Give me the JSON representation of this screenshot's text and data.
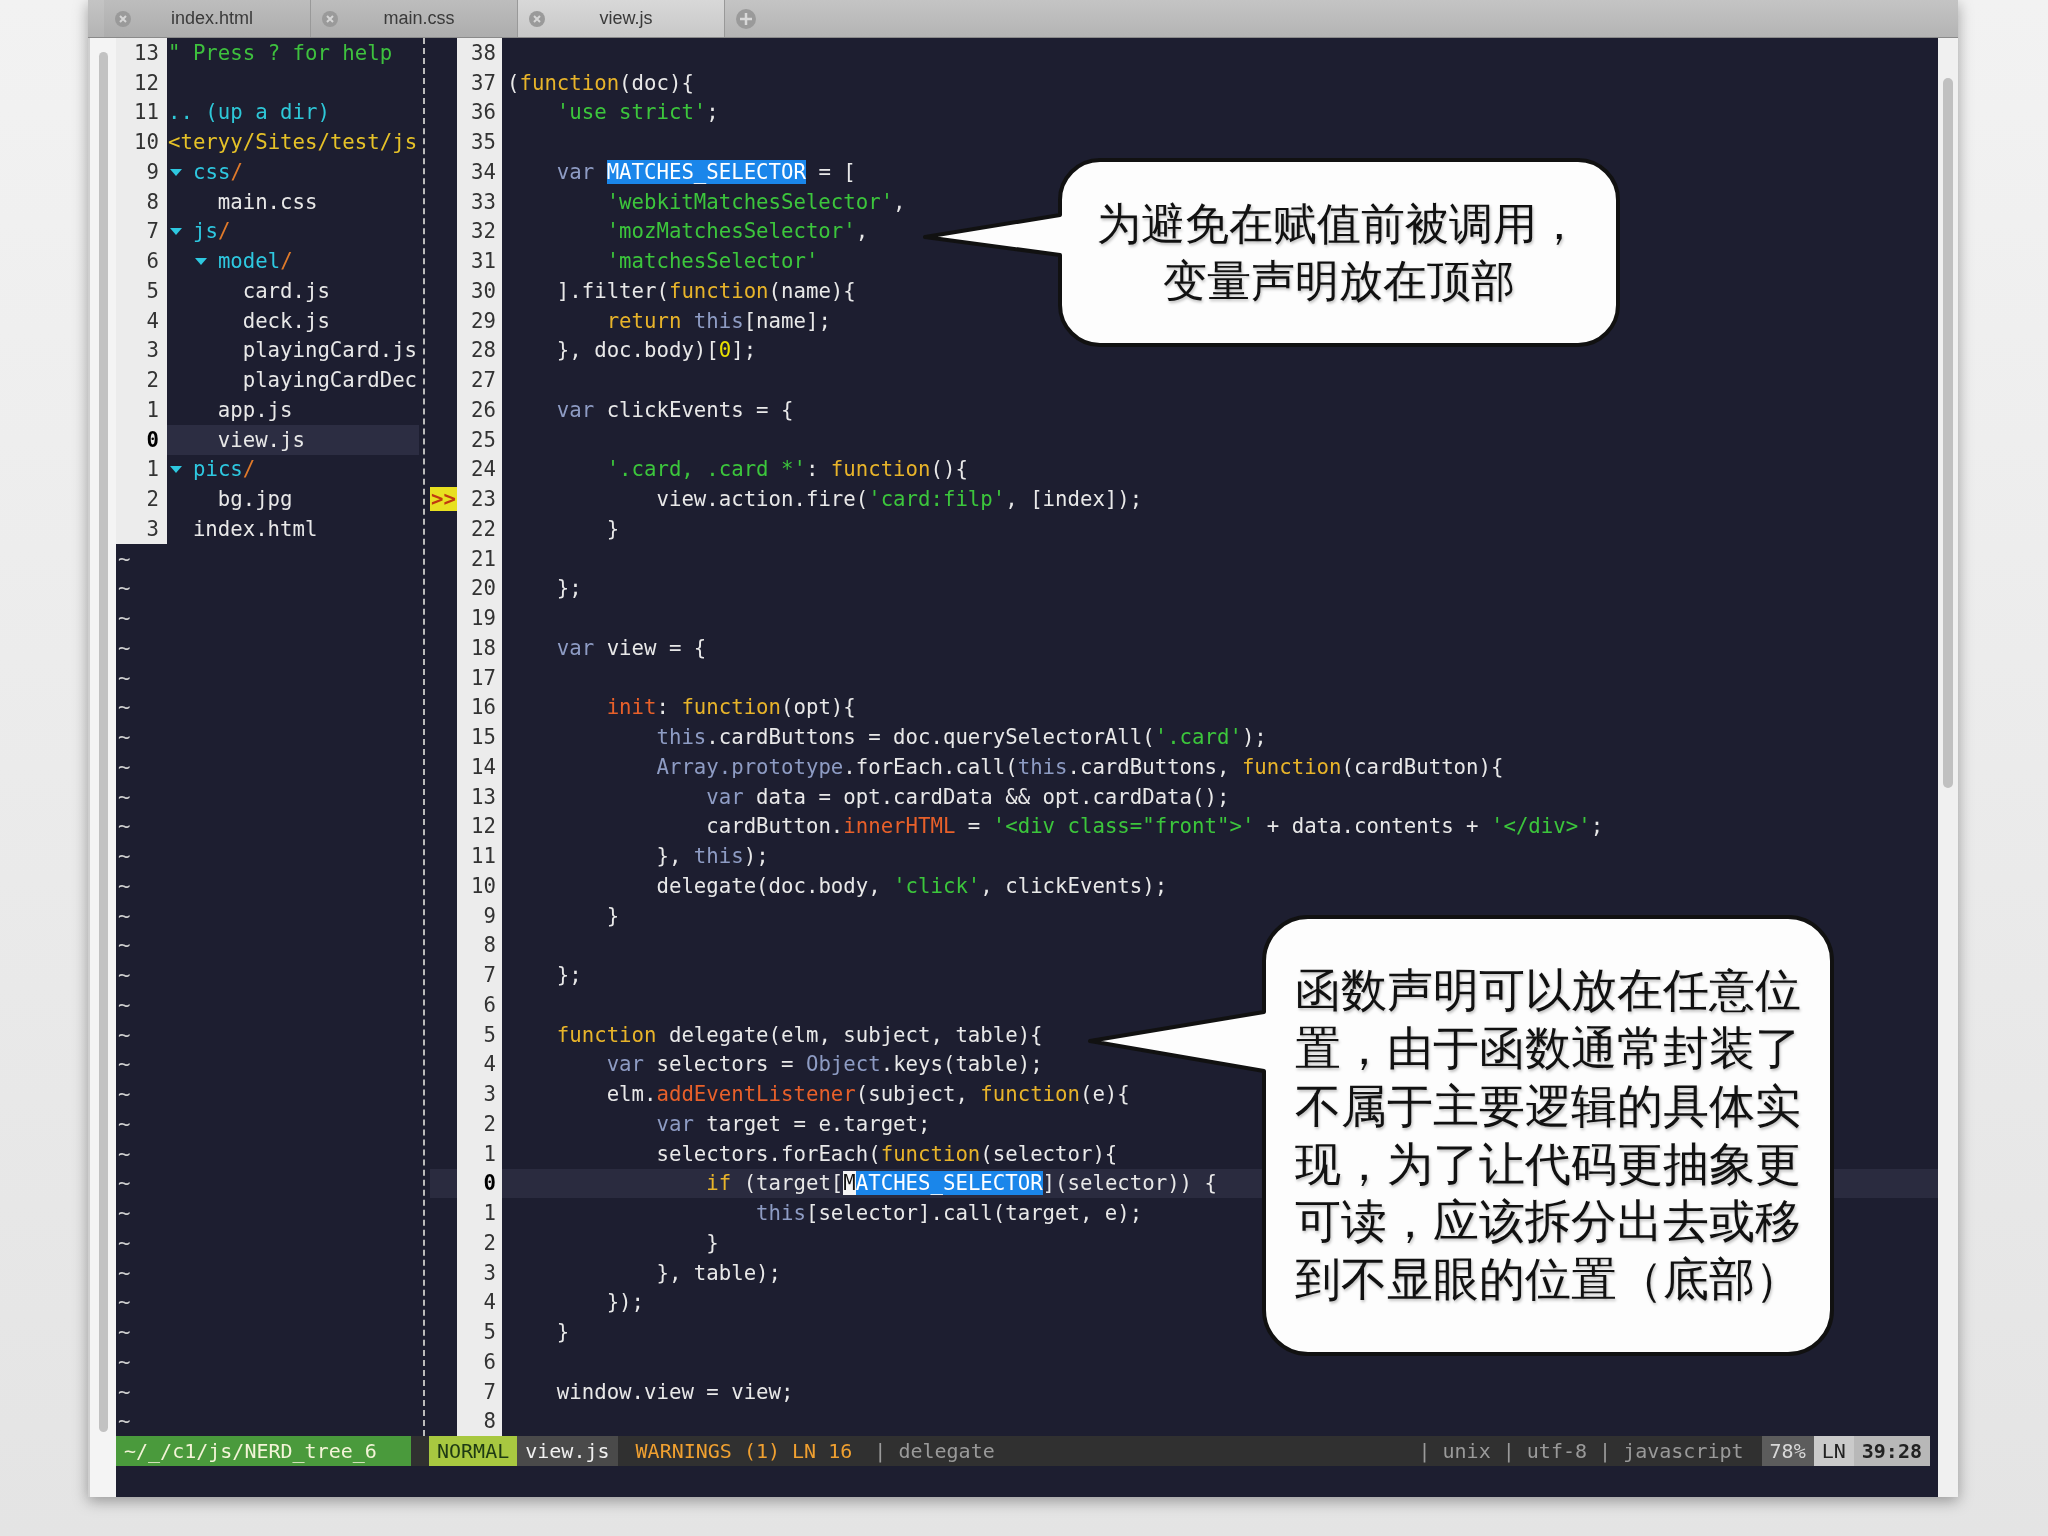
{
  "tabs": [
    {
      "label": "index.html",
      "selected": false
    },
    {
      "label": "main.css",
      "selected": false
    },
    {
      "label": "view.js",
      "selected": true
    }
  ],
  "tree": {
    "help": {
      "number": "13",
      "text": "\" Press ? for help"
    },
    "blank": {
      "number": "12"
    },
    "updir": {
      "number": "11",
      "text": ".. (up a dir)"
    },
    "root": {
      "number": "10",
      "text": "<teryy/Sites/test/js",
      "children": [
        {
          "number": "9",
          "name": "css/",
          "kind": "dir",
          "expanded": true,
          "selected": false,
          "children": [
            {
              "number": "8",
              "name": "main.css",
              "kind": "file",
              "selected": false
            }
          ]
        },
        {
          "number": "7",
          "name": "js/",
          "kind": "dir",
          "expanded": true,
          "selected": false,
          "children": [
            {
              "number": "6",
              "name": "model/",
              "kind": "dir",
              "expanded": true,
              "selected": false,
              "children": [
                {
                  "number": "5",
                  "name": "card.js",
                  "kind": "file",
                  "selected": false
                },
                {
                  "number": "4",
                  "name": "deck.js",
                  "kind": "file",
                  "selected": false
                },
                {
                  "number": "3",
                  "name": "playingCard.js",
                  "kind": "file",
                  "selected": false
                },
                {
                  "number": "2",
                  "name": "playingCardDec",
                  "kind": "file",
                  "selected": false
                }
              ]
            },
            {
              "number": "1",
              "name": "app.js",
              "kind": "file",
              "selected": false
            },
            {
              "number": "0",
              "name": "view.js",
              "kind": "file",
              "selected": true
            }
          ]
        },
        {
          "number": "1",
          "name": "pics/",
          "kind": "dir",
          "expanded": true,
          "selected": false,
          "children": [
            {
              "number": "2",
              "name": "bg.jpg",
              "kind": "file",
              "selected": false
            }
          ]
        },
        {
          "number": "3",
          "name": "index.html",
          "kind": "file",
          "selected": false
        }
      ]
    },
    "filler": [
      "~",
      "~",
      "~",
      "~",
      "~",
      "~",
      "~",
      "~",
      "~",
      "~",
      "~",
      "~",
      "~",
      "~",
      "~",
      "~",
      "~",
      "~",
      "~",
      "~",
      "~",
      "~",
      "~",
      "~",
      "~",
      "~",
      "~",
      "~",
      "~",
      "~"
    ]
  },
  "code": {
    "lines": [
      {
        "number": "38",
        "current": false
      },
      {
        "number": "37",
        "current": false,
        "tokens": [
          {
            "kind": "plain",
            "text": "("
          },
          {
            "kind": "keyword",
            "text": "function"
          },
          {
            "kind": "plain",
            "text": "(doc){"
          }
        ]
      },
      {
        "number": "36",
        "current": false,
        "tokens": [
          {
            "kind": "string",
            "text": "    'use strict'"
          },
          {
            "kind": "plain",
            "text": ";"
          }
        ]
      },
      {
        "number": "35",
        "current": false
      },
      {
        "number": "34",
        "current": false,
        "tokens": [
          {
            "kind": "storage",
            "text": "    var "
          },
          {
            "kind": "match",
            "text": "MATCHES_SELECTOR"
          },
          {
            "kind": "plain",
            "text": " = ["
          }
        ]
      },
      {
        "number": "33",
        "current": false,
        "tokens": [
          {
            "kind": "string",
            "text": "        'webkitMatchesSelector'"
          },
          {
            "kind": "plain",
            "text": ","
          }
        ]
      },
      {
        "number": "32",
        "current": false,
        "tokens": [
          {
            "kind": "string",
            "text": "        'mozMatchesSelector'"
          },
          {
            "kind": "plain",
            "text": ","
          }
        ]
      },
      {
        "number": "31",
        "current": false,
        "tokens": [
          {
            "kind": "string",
            "text": "        'matchesSelector'"
          }
        ]
      },
      {
        "number": "30",
        "current": false,
        "tokens": [
          {
            "kind": "plain",
            "text": "    ].filter("
          },
          {
            "kind": "keyword",
            "text": "function"
          },
          {
            "kind": "plain",
            "text": "(name){"
          }
        ]
      },
      {
        "number": "29",
        "current": false,
        "tokens": [
          {
            "kind": "keyword",
            "text": "        return "
          },
          {
            "kind": "storage",
            "text": "this"
          },
          {
            "kind": "plain",
            "text": "[name];"
          }
        ]
      },
      {
        "number": "28",
        "current": false,
        "tokens": [
          {
            "kind": "plain",
            "text": "    }, doc.body)["
          },
          {
            "kind": "number",
            "text": "0"
          },
          {
            "kind": "plain",
            "text": "];"
          }
        ]
      },
      {
        "number": "27",
        "current": false
      },
      {
        "number": "26",
        "current": false,
        "tokens": [
          {
            "kind": "storage",
            "text": "    var"
          },
          {
            "kind": "plain",
            "text": " clickEvents = {"
          }
        ]
      },
      {
        "number": "25",
        "current": false
      },
      {
        "number": "24",
        "current": false,
        "tokens": [
          {
            "kind": "string",
            "text": "        '.card, .card *'"
          },
          {
            "kind": "plain",
            "text": ": "
          },
          {
            "kind": "keyword",
            "text": "function"
          },
          {
            "kind": "plain",
            "text": "(){"
          }
        ]
      },
      {
        "number": "23",
        "current": false,
        "sign": ">>",
        "tokens": [
          {
            "kind": "plain",
            "text": "            view.action.fire("
          },
          {
            "kind": "string",
            "text": "'card:filp'"
          },
          {
            "kind": "plain",
            "text": ", [index]);"
          }
        ]
      },
      {
        "number": "22",
        "current": false,
        "tokens": [
          {
            "kind": "plain",
            "text": "        }"
          }
        ]
      },
      {
        "number": "21",
        "current": false
      },
      {
        "number": "20",
        "current": false,
        "tokens": [
          {
            "kind": "plain",
            "text": "    };"
          }
        ]
      },
      {
        "number": "19",
        "current": false
      },
      {
        "number": "18",
        "current": false,
        "tokens": [
          {
            "kind": "storage",
            "text": "    var"
          },
          {
            "kind": "plain",
            "text": " view = {"
          }
        ]
      },
      {
        "number": "17",
        "current": false
      },
      {
        "number": "16",
        "current": false,
        "tokens": [
          {
            "kind": "property",
            "text": "        init"
          },
          {
            "kind": "plain",
            "text": ": "
          },
          {
            "kind": "keyword",
            "text": "function"
          },
          {
            "kind": "plain",
            "text": "(opt){"
          }
        ]
      },
      {
        "number": "15",
        "current": false,
        "tokens": [
          {
            "kind": "storage",
            "text": "            this"
          },
          {
            "kind": "plain",
            "text": ".cardButtons = doc.querySelectorAll("
          },
          {
            "kind": "string",
            "text": "'.card'"
          },
          {
            "kind": "plain",
            "text": ");"
          }
        ]
      },
      {
        "number": "14",
        "current": false,
        "tokens": [
          {
            "kind": "storage",
            "text": "            Array.prototype"
          },
          {
            "kind": "plain",
            "text": ".forEach.call("
          },
          {
            "kind": "storage",
            "text": "this"
          },
          {
            "kind": "plain",
            "text": ".cardButtons, "
          },
          {
            "kind": "keyword",
            "text": "function"
          },
          {
            "kind": "plain",
            "text": "(cardButton){"
          }
        ]
      },
      {
        "number": "13",
        "current": false,
        "tokens": [
          {
            "kind": "storage",
            "text": "                var"
          },
          {
            "kind": "plain",
            "text": " data = opt.cardData && opt.cardData();"
          }
        ]
      },
      {
        "number": "12",
        "current": false,
        "tokens": [
          {
            "kind": "plain",
            "text": "                cardButton."
          },
          {
            "kind": "property",
            "text": "innerHTML"
          },
          {
            "kind": "plain",
            "text": " = "
          },
          {
            "kind": "string",
            "text": "'<div class=\"front\">'"
          },
          {
            "kind": "plain",
            "text": " + data.contents + "
          },
          {
            "kind": "string",
            "text": "'</div>'"
          },
          {
            "kind": "plain",
            "text": ";"
          }
        ]
      },
      {
        "number": "11",
        "current": false,
        "tokens": [
          {
            "kind": "plain",
            "text": "            }, "
          },
          {
            "kind": "storage",
            "text": "this"
          },
          {
            "kind": "plain",
            "text": ");"
          }
        ]
      },
      {
        "number": "10",
        "current": false,
        "tokens": [
          {
            "kind": "plain",
            "text": "            delegate(doc.body, "
          },
          {
            "kind": "string",
            "text": "'click'"
          },
          {
            "kind": "plain",
            "text": ", clickEvents);"
          }
        ]
      },
      {
        "number": "9",
        "current": false,
        "tokens": [
          {
            "kind": "plain",
            "text": "        }"
          }
        ]
      },
      {
        "number": "8",
        "current": false
      },
      {
        "number": "7",
        "current": false,
        "tokens": [
          {
            "kind": "plain",
            "text": "    };"
          }
        ]
      },
      {
        "number": "6",
        "current": false
      },
      {
        "number": "5",
        "current": false,
        "tokens": [
          {
            "kind": "keyword",
            "text": "    function"
          },
          {
            "kind": "plain",
            "text": " delegate(elm, subject, table){"
          }
        ]
      },
      {
        "number": "4",
        "current": false,
        "tokens": [
          {
            "kind": "storage",
            "text": "        var"
          },
          {
            "kind": "plain",
            "text": " selectors = "
          },
          {
            "kind": "storage",
            "text": "Object"
          },
          {
            "kind": "plain",
            "text": ".keys(table);"
          }
        ]
      },
      {
        "number": "3",
        "current": false,
        "tokens": [
          {
            "kind": "plain",
            "text": "        elm."
          },
          {
            "kind": "property",
            "text": "addEventListener"
          },
          {
            "kind": "plain",
            "text": "(subject, "
          },
          {
            "kind": "keyword",
            "text": "function"
          },
          {
            "kind": "plain",
            "text": "(e){"
          }
        ]
      },
      {
        "number": "2",
        "current": false,
        "tokens": [
          {
            "kind": "storage",
            "text": "            var"
          },
          {
            "kind": "plain",
            "text": " target = e.target;"
          }
        ]
      },
      {
        "number": "1",
        "current": false,
        "tokens": [
          {
            "kind": "plain",
            "text": "            selectors.forEach("
          },
          {
            "kind": "keyword",
            "text": "function"
          },
          {
            "kind": "plain",
            "text": "(selector){"
          }
        ]
      },
      {
        "number": "0",
        "current": true,
        "tokens": [
          {
            "kind": "keyword",
            "text": "                if"
          },
          {
            "kind": "plain",
            "text": " (target["
          },
          {
            "kind": "cursor",
            "text": "M"
          },
          {
            "kind": "match",
            "text": "ATCHES_SELECTOR"
          },
          {
            "kind": "plain",
            "text": "](selector)) {"
          }
        ]
      },
      {
        "number": "1",
        "current": false,
        "tokens": [
          {
            "kind": "storage",
            "text": "                    this"
          },
          {
            "kind": "plain",
            "text": "[selector].call(target, e);"
          }
        ]
      },
      {
        "number": "2",
        "current": false,
        "tokens": [
          {
            "kind": "plain",
            "text": "                }"
          }
        ]
      },
      {
        "number": "3",
        "current": false,
        "tokens": [
          {
            "kind": "plain",
            "text": "            }, table);"
          }
        ]
      },
      {
        "number": "4",
        "current": false,
        "tokens": [
          {
            "kind": "plain",
            "text": "        });"
          }
        ]
      },
      {
        "number": "5",
        "current": false,
        "tokens": [
          {
            "kind": "plain",
            "text": "    }"
          }
        ]
      },
      {
        "number": "6",
        "current": false
      },
      {
        "number": "7",
        "current": false,
        "tokens": [
          {
            "kind": "plain",
            "text": "    window.view = view;"
          }
        ]
      },
      {
        "number": "8",
        "current": false
      }
    ]
  },
  "status_bar": {
    "left": [
      {
        "kind": "path",
        "text": "~/_/c1/js/NERD_tree_6"
      },
      {
        "kind": "mode",
        "text": "NORMAL"
      },
      {
        "kind": "file",
        "text": "view.js"
      },
      {
        "kind": "warning",
        "text": "WARNINGS (1) LN 16"
      },
      {
        "kind": "info",
        "text": "| delegate"
      }
    ],
    "right": [
      {
        "kind": "info",
        "text": "| unix | utf-8 | javascript"
      },
      {
        "kind": "percent",
        "text": "78%"
      },
      {
        "kind": "label",
        "text": "LN"
      },
      {
        "kind": "position",
        "text": "39:28"
      }
    ]
  },
  "callouts": [
    {
      "lines": [
        "为避免在赋值前被调用，",
        "变量声明放在顶部"
      ]
    },
    {
      "lines": [
        "函数声明可以放在任意位",
        "置，由于函数通常封装了",
        "不属于主要逻辑的具体实",
        "现，为了让代码更抽象更",
        "可读，应该拆分出去或移",
        "到不显眼的位置（底部）"
      ]
    }
  ]
}
